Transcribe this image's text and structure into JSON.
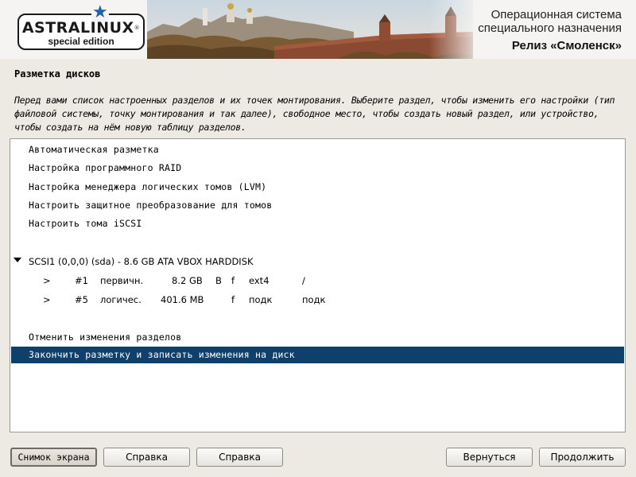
{
  "header": {
    "logo_name": "ASTRALINUX",
    "logo_registered": "®",
    "logo_edition": "special edition",
    "subtitle_line1": "Операционная система",
    "subtitle_line2": "специального назначения",
    "release": "Релиз «Смоленск»"
  },
  "page_title": "Разметка дисков",
  "description": "Перед вами список настроенных разделов и их точек монтирования. Выберите раздел, чтобы изменить его настройки (тип файловой системы, точку монтирования и так далее), свободное место, чтобы создать новый раздел, или устройство, чтобы создать на нём новую таблицу разделов.",
  "list": {
    "options": [
      "Автоматическая разметка",
      "Настройка программного RAID",
      "Настройка менеджера логических томов (LVM)",
      "Настроить защитное преобразование для томов",
      "Настроить тома iSCSI"
    ],
    "disk": "SCSI1 (0,0,0) (sda) - 8.6 GB ATA VBOX HARDDISK",
    "partitions": [
      {
        "arrow": ">",
        "num": "#1",
        "type": "первичн.",
        "size": "8.2 GB",
        "boot": "B",
        "fmt": "f",
        "fs": "ext4",
        "mount": "/"
      },
      {
        "arrow": ">",
        "num": "#5",
        "type": "логичес.",
        "size": "401.6 MB",
        "boot": "",
        "fmt": "f",
        "fs": "подк",
        "mount": "подк"
      }
    ],
    "undo": "Отменить изменения разделов",
    "finish": "Закончить разметку и записать изменения на диск"
  },
  "buttons": {
    "screenshot": "Снимок экрана",
    "help1": "Справка",
    "help2": "Справка",
    "back": "Вернуться",
    "continue": "Продолжить"
  },
  "colors": {
    "selection": "#0f3f6b",
    "background": "#ede9e3",
    "logo_star": "#1e5fae"
  }
}
